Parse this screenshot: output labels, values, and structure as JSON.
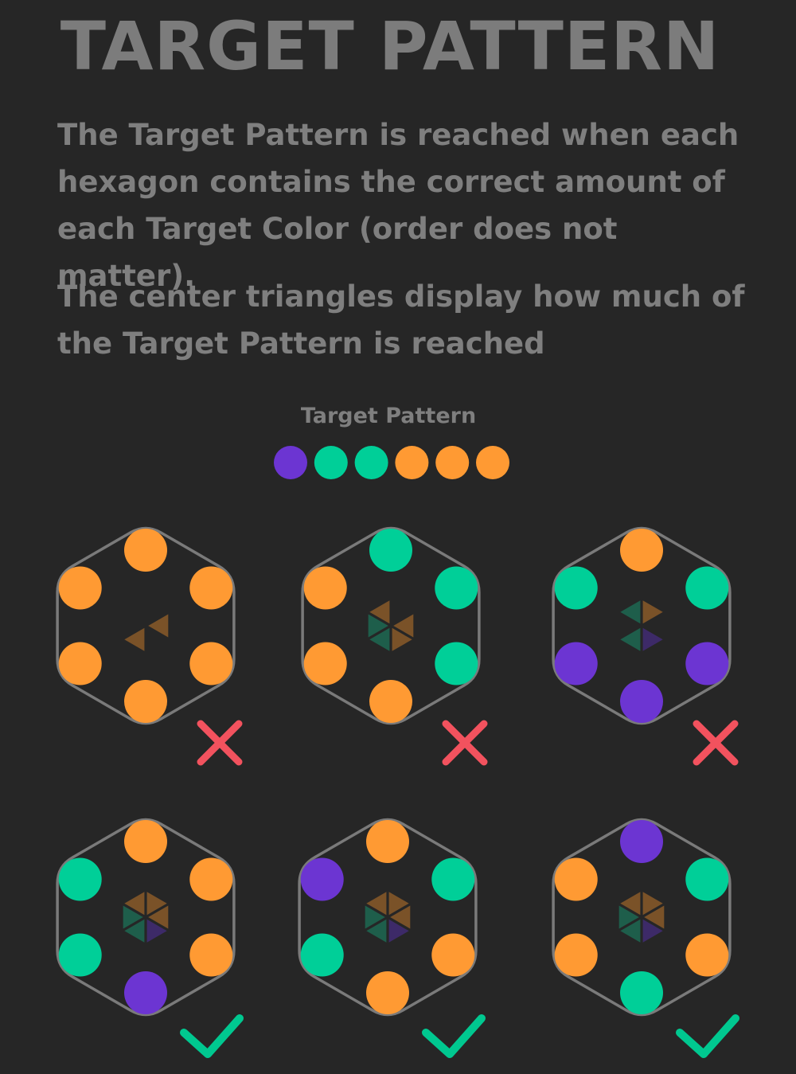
{
  "title": "TARGET PATTERN",
  "description": {
    "paragraph1": "The Target Pattern is reached when each hexagon contains the correct amount of each Target Color (order does not matter).",
    "paragraph2": "The center triangles display how much of the Target Pattern is reached"
  },
  "colors": {
    "background": "#262626",
    "text": "#7f7f7f",
    "hex_outline": "#7a7a7a",
    "purple": "#6c35d2",
    "teal": "#00cf98",
    "orange": "#ff9a33",
    "dim_purple": "#3d2a68",
    "dim_teal": "#1e5e4b",
    "dim_orange": "#7a5228",
    "fail": "#f2525e",
    "pass": "#00c890"
  },
  "target_pattern": {
    "label": "Target Pattern",
    "dots": [
      "purple",
      "teal",
      "teal",
      "orange",
      "orange",
      "orange"
    ]
  },
  "examples": [
    {
      "circles": [
        "orange",
        "orange",
        "orange",
        "orange",
        "orange",
        "orange"
      ],
      "triangles": [
        null,
        "orange",
        null,
        "orange",
        null,
        null
      ],
      "result": "fail"
    },
    {
      "circles": [
        "teal",
        "teal",
        "teal",
        "orange",
        "orange",
        "orange"
      ],
      "triangles": [
        null,
        "orange",
        "orange",
        "teal",
        "teal",
        "orange"
      ],
      "result": "fail"
    },
    {
      "circles": [
        "orange",
        "teal",
        "purple",
        "purple",
        "purple",
        "teal"
      ],
      "triangles": [
        "orange",
        null,
        "purple",
        "teal",
        null,
        "teal"
      ],
      "result": "fail"
    },
    {
      "circles": [
        "orange",
        "orange",
        "orange",
        "purple",
        "teal",
        "teal"
      ],
      "triangles": [
        "orange",
        "orange",
        "purple",
        "teal",
        "teal",
        "orange"
      ],
      "result": "pass"
    },
    {
      "circles": [
        "orange",
        "teal",
        "orange",
        "orange",
        "teal",
        "purple"
      ],
      "triangles": [
        "orange",
        "orange",
        "purple",
        "teal",
        "teal",
        "orange"
      ],
      "result": "pass"
    },
    {
      "circles": [
        "purple",
        "teal",
        "orange",
        "teal",
        "orange",
        "orange"
      ],
      "triangles": [
        "orange",
        "orange",
        "purple",
        "teal",
        "teal",
        "orange"
      ],
      "result": "pass"
    }
  ]
}
